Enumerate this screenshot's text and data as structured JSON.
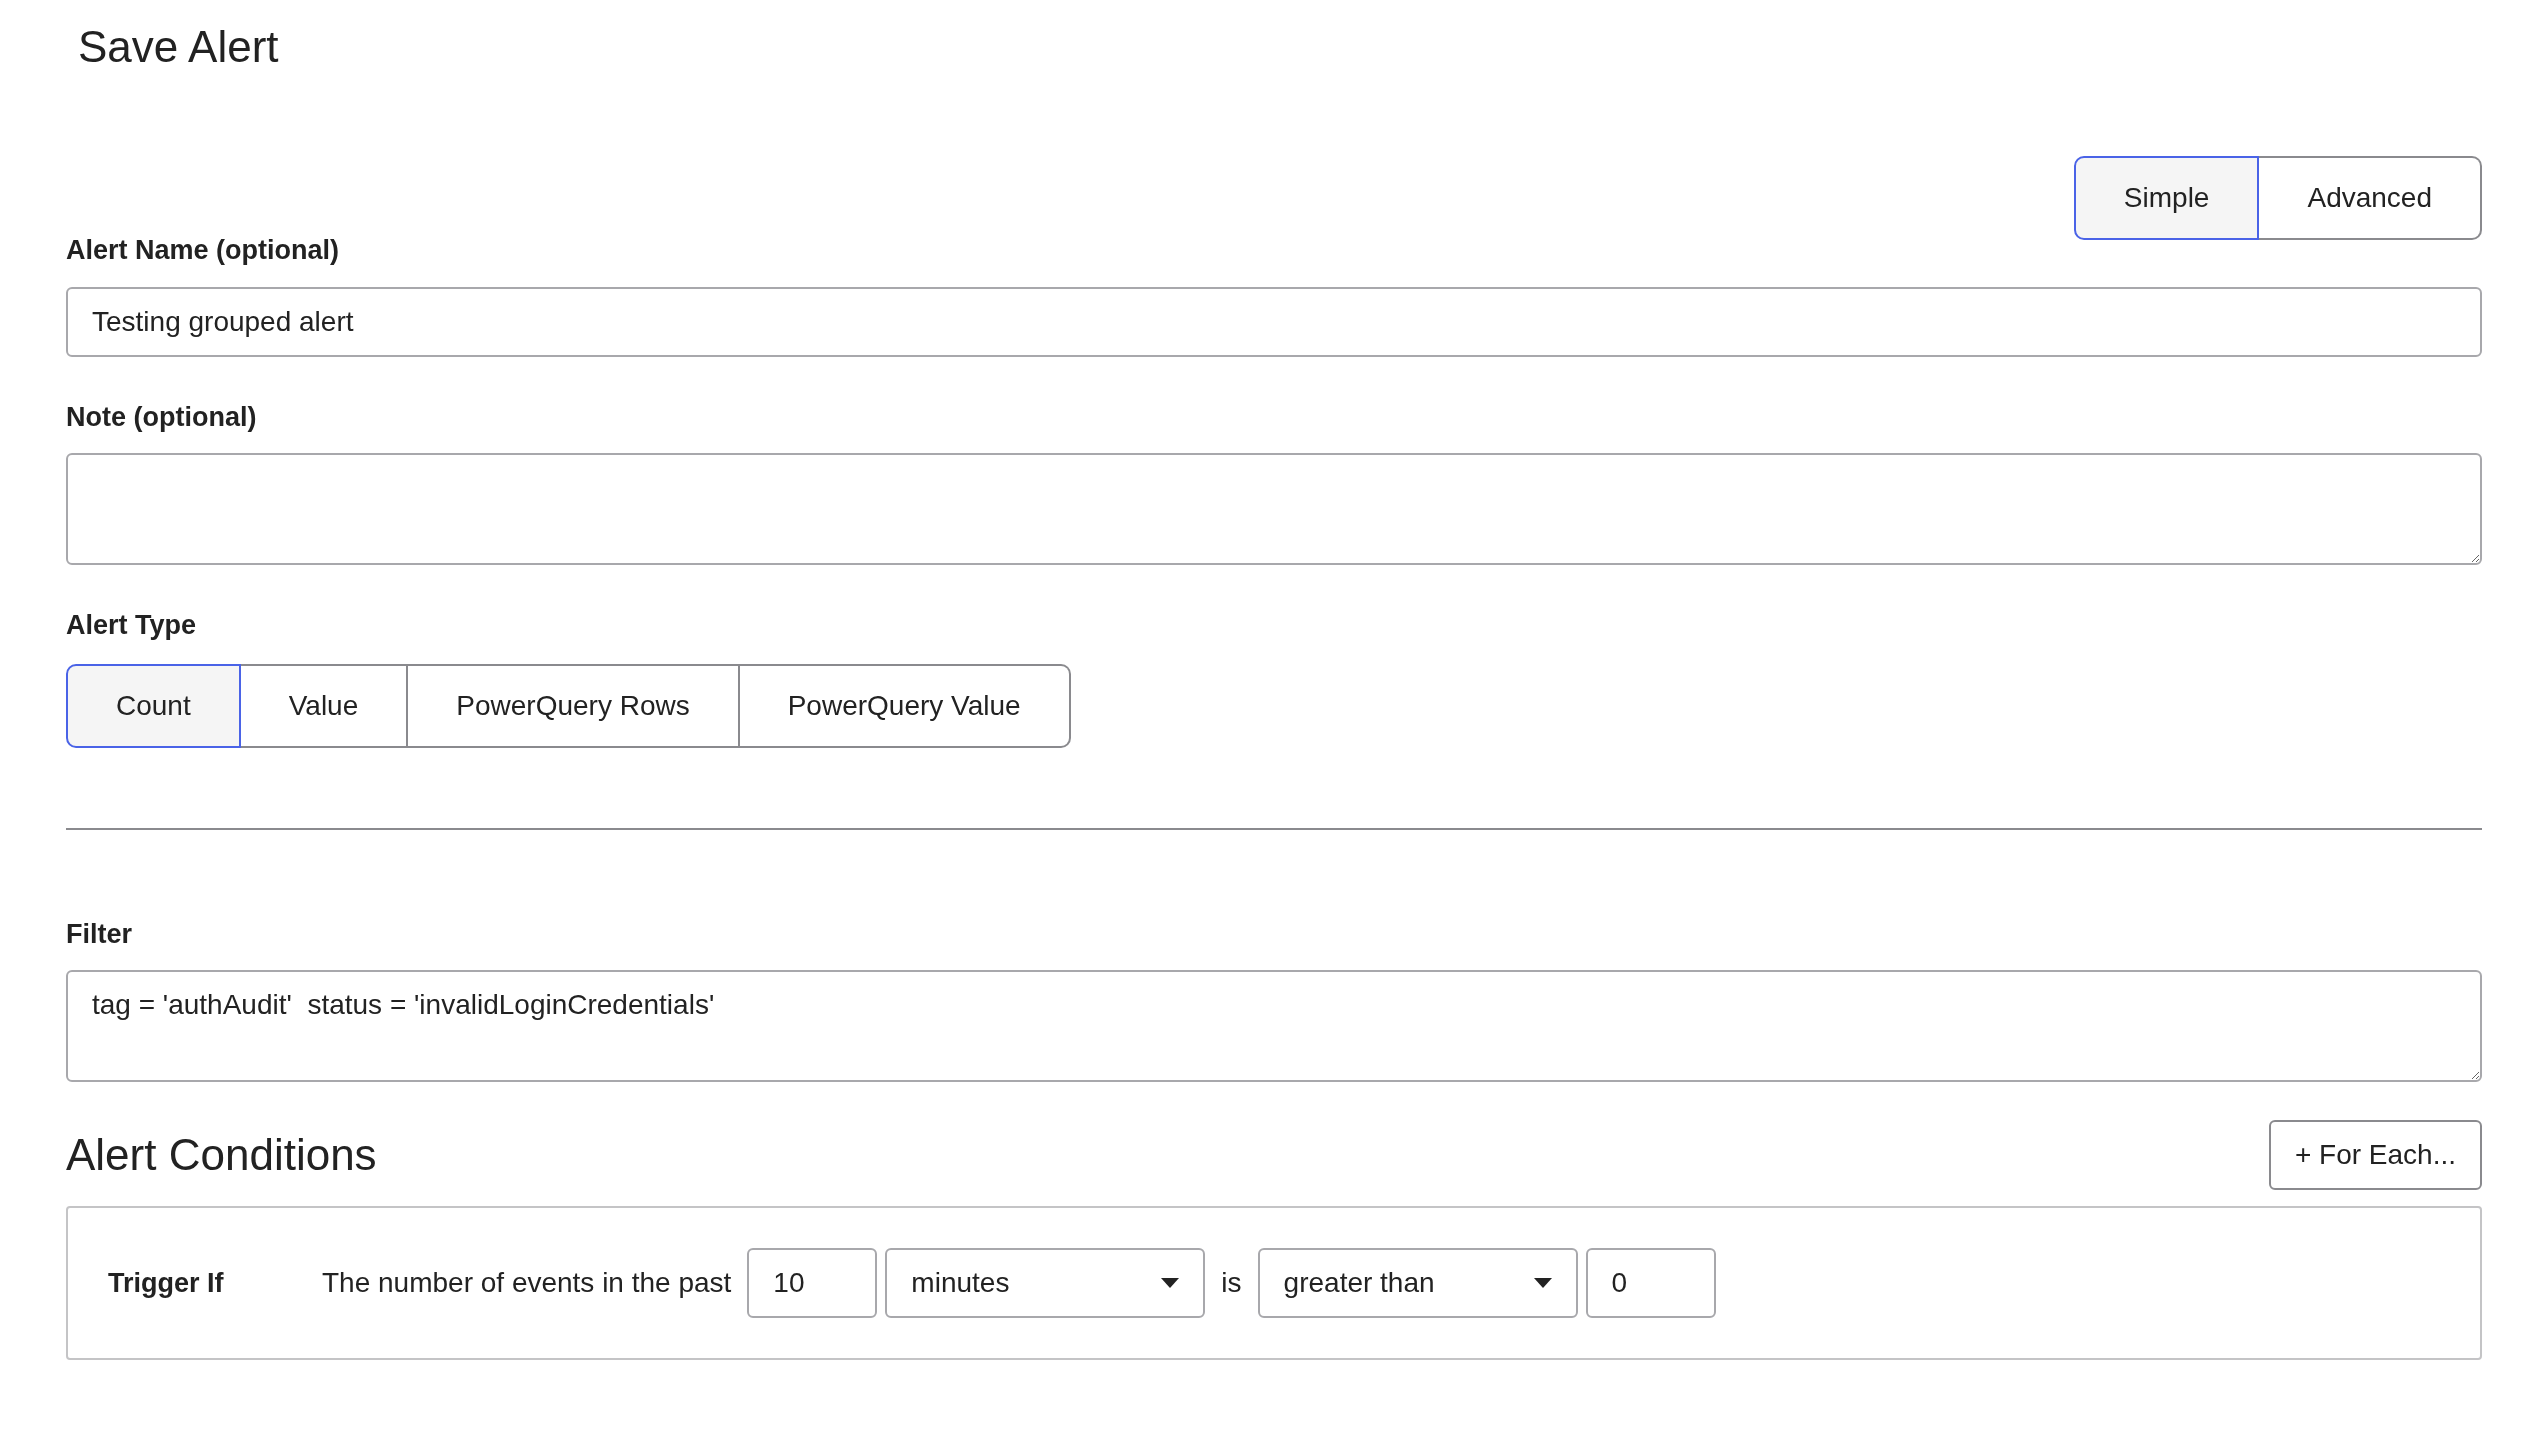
{
  "title": "Save Alert",
  "mode_toggle": [
    {
      "label": "Simple",
      "selected": true
    },
    {
      "label": "Advanced",
      "selected": false
    }
  ],
  "alert_name": {
    "label": "Alert Name (optional)",
    "value": "Testing grouped alert"
  },
  "note": {
    "label": "Note (optional)"
  },
  "alert_type": {
    "label": "Alert Type",
    "options": [
      {
        "label": "Count",
        "selected": true
      },
      {
        "label": "Value",
        "selected": false
      },
      {
        "label": "PowerQuery Rows",
        "selected": false
      },
      {
        "label": "PowerQuery Value",
        "selected": false
      }
    ]
  },
  "filter": {
    "label": "Filter",
    "value": "tag = 'authAudit'  status = 'invalidLoginCredentials'"
  },
  "conditions": {
    "heading": "Alert Conditions",
    "for_each_button": "+ For Each...",
    "trigger_label": "Trigger If",
    "sentence": "The number of events in the past",
    "count": "10",
    "unit": "minutes",
    "connector": "is",
    "comparison": "greater than",
    "threshold": "0"
  }
}
